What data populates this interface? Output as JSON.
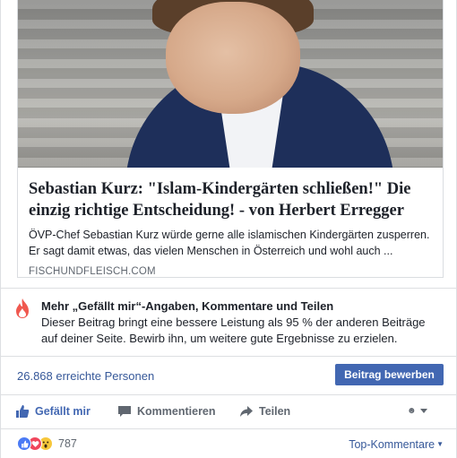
{
  "link_preview": {
    "title": "Sebastian Kurz: \"Islam-Kindergärten schließen!\" Die einzig richtige Entscheidung! - von Herbert Erregger",
    "description": "ÖVP-Chef Sebastian Kurz würde gerne alle islamischen Kindergärten zusperren. Er sagt damit etwas, das vielen Menschen in Österreich und wohl auch ...",
    "domain": "FISCHUNDFLEISCH.COM"
  },
  "insight": {
    "icon": "flame-icon",
    "title": "Mehr „Gefällt mir“-Angaben, Kommentare und Teilen",
    "body": "Dieser Beitrag bringt eine bessere Leistung als 95 % der anderen Beiträge auf deiner Seite. Bewirb ihn, um weitere gute Ergebnisse zu erzielen."
  },
  "reach": {
    "text": "26.868 erreichte Personen",
    "button_label": "Beitrag bewerben"
  },
  "actions": {
    "like": "Gefällt mir",
    "comment": "Kommentieren",
    "share": "Teilen"
  },
  "footer": {
    "reaction_count": "787",
    "reactions": [
      "like",
      "love",
      "wow"
    ],
    "sort_label": "Top-Kommentare"
  },
  "colors": {
    "accent": "#4267b2",
    "link": "#365899",
    "flame": "#f0584f"
  }
}
